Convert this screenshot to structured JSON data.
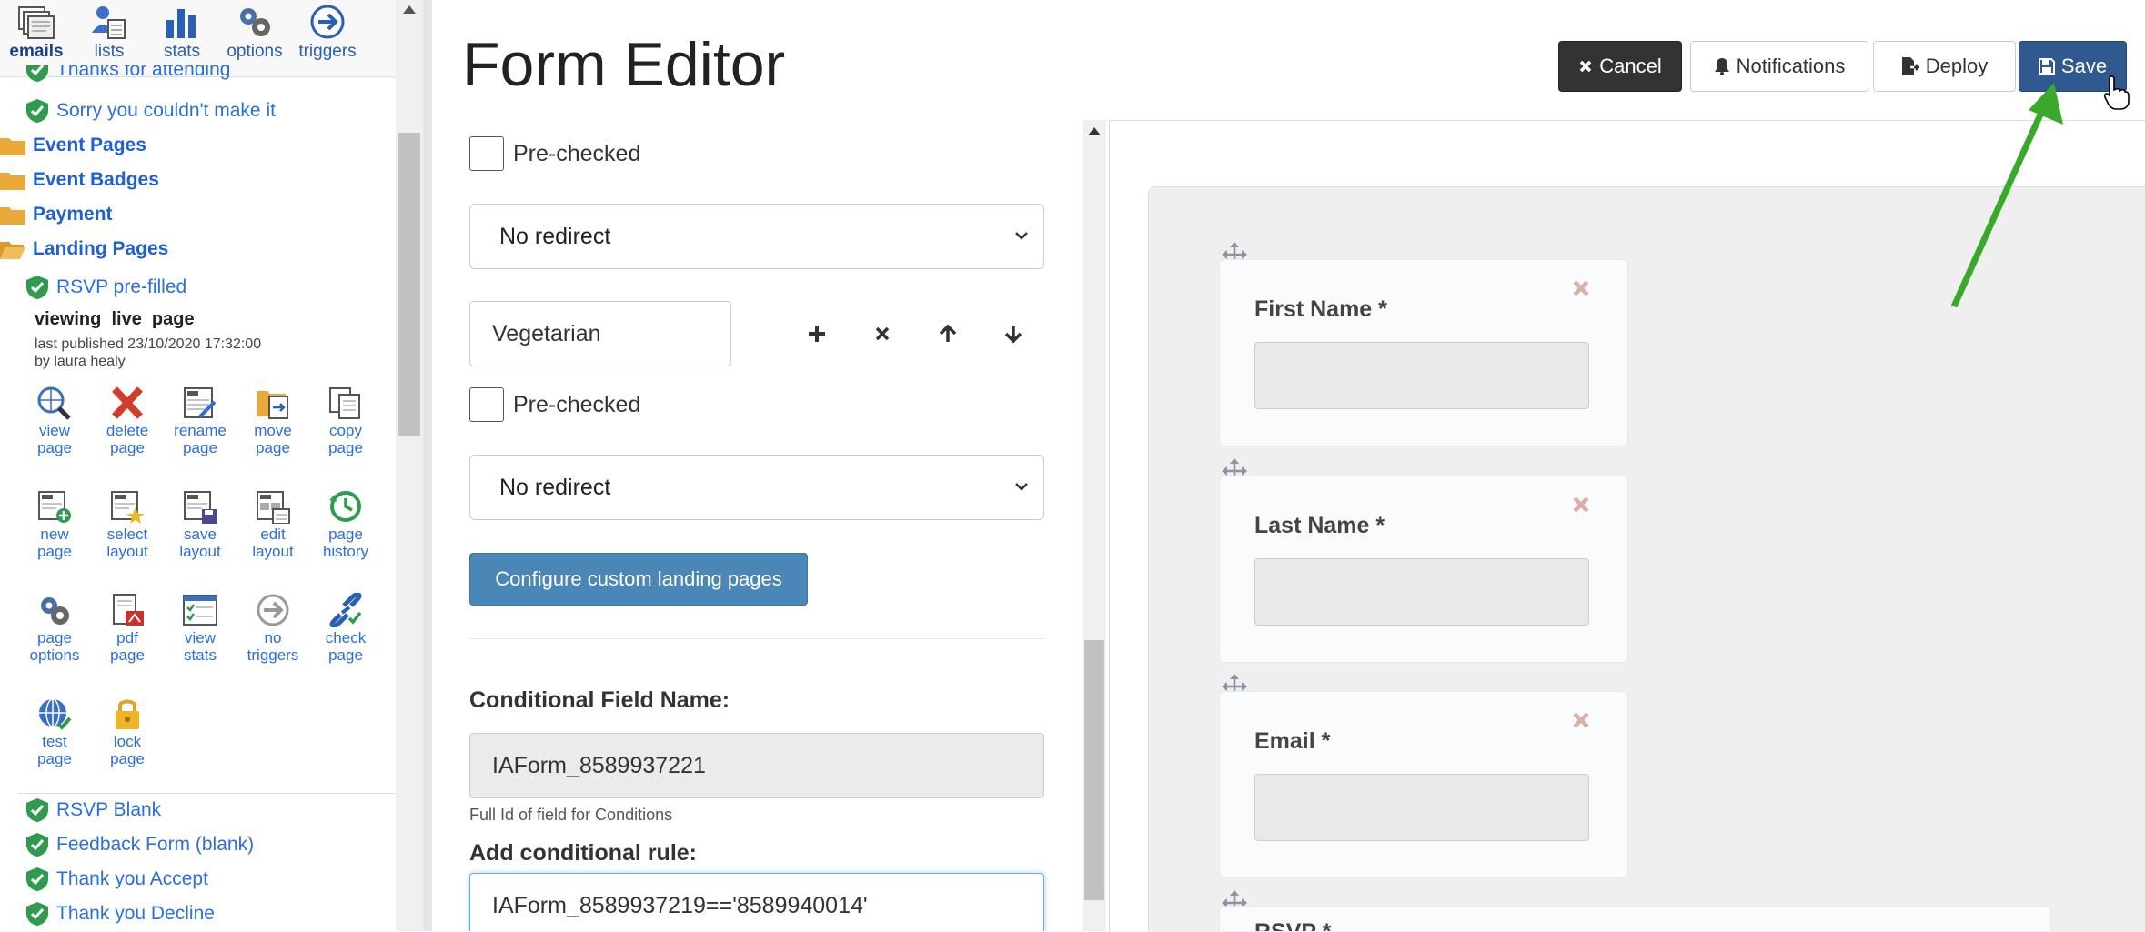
{
  "nav": [
    {
      "label": "emails",
      "icon": "emails-icon",
      "active": true
    },
    {
      "label": "lists",
      "icon": "lists-icon"
    },
    {
      "label": "stats",
      "icon": "stats-icon"
    },
    {
      "label": "options",
      "icon": "options-icon"
    },
    {
      "label": "triggers",
      "icon": "triggers-icon"
    }
  ],
  "tree": {
    "partial_item": "Thanks for attending",
    "item_sorry": "Sorry you couldn't make it",
    "folders": [
      "Event Pages",
      "Event Badges",
      "Payment",
      "Landing Pages"
    ],
    "selected_page": "RSVP pre-filled",
    "page_info": {
      "status": "viewing  live  page",
      "published": "last published 23/10/2020 17:32:00",
      "by": "by laura healy"
    },
    "tools": [
      {
        "line1": "view",
        "line2": "page",
        "icon": "view-page-icon"
      },
      {
        "line1": "delete",
        "line2": "page",
        "icon": "delete-page-icon"
      },
      {
        "line1": "rename",
        "line2": "page",
        "icon": "rename-page-icon"
      },
      {
        "line1": "move",
        "line2": "page",
        "icon": "move-page-icon"
      },
      {
        "line1": "copy",
        "line2": "page",
        "icon": "copy-page-icon"
      },
      {
        "line1": "new",
        "line2": "page",
        "icon": "new-page-icon"
      },
      {
        "line1": "select",
        "line2": "layout",
        "icon": "select-layout-icon"
      },
      {
        "line1": "save",
        "line2": "layout",
        "icon": "save-layout-icon"
      },
      {
        "line1": "edit",
        "line2": "layout",
        "icon": "edit-layout-icon"
      },
      {
        "line1": "page",
        "line2": "history",
        "icon": "page-history-icon"
      },
      {
        "line1": "page",
        "line2": "options",
        "icon": "page-options-icon"
      },
      {
        "line1": "pdf",
        "line2": "page",
        "icon": "pdf-page-icon"
      },
      {
        "line1": "view",
        "line2": "stats",
        "icon": "view-stats-icon"
      },
      {
        "line1": "no",
        "line2": "triggers",
        "icon": "no-triggers-icon"
      },
      {
        "line1": "check",
        "line2": "page",
        "icon": "check-page-icon"
      },
      {
        "line1": "test",
        "line2": "page",
        "icon": "test-page-icon"
      },
      {
        "line1": "lock",
        "line2": "page",
        "icon": "lock-page-icon"
      }
    ],
    "items_after": [
      "RSVP Blank",
      "Feedback Form (blank)",
      "Thank you Accept",
      "Thank you Decline"
    ]
  },
  "header": {
    "title": "Form Editor",
    "cancel": "Cancel",
    "notifications": "Notifications",
    "deploy": "Deploy",
    "save": "Save"
  },
  "form": {
    "prechecked_1": "Pre-checked",
    "redirect_1": "No redirect",
    "option_value": "Vegetarian",
    "prechecked_2": "Pre-checked",
    "redirect_2": "No redirect",
    "configure_btn": "Configure custom landing pages",
    "cond_field_label": "Conditional Field Name:",
    "cond_field_value": "IAForm_8589937221",
    "cond_field_help": "Full Id of field for Conditions",
    "cond_rule_label": "Add conditional rule:",
    "cond_rule_value": "IAForm_8589937219=='8589940014'"
  },
  "preview": {
    "fields": [
      {
        "label": "First Name *"
      },
      {
        "label": "Last Name *"
      },
      {
        "label": "Email *"
      }
    ],
    "partial_label": "RSVP *"
  },
  "colors": {
    "link": "#2a6fdb",
    "save_button": "#30598f",
    "cancel_button": "#333333",
    "config_button": "#4a87b7",
    "annotation_arrow": "#3aa82b",
    "check_shield": "#2e9b4f",
    "folder": "#e8a93a"
  }
}
